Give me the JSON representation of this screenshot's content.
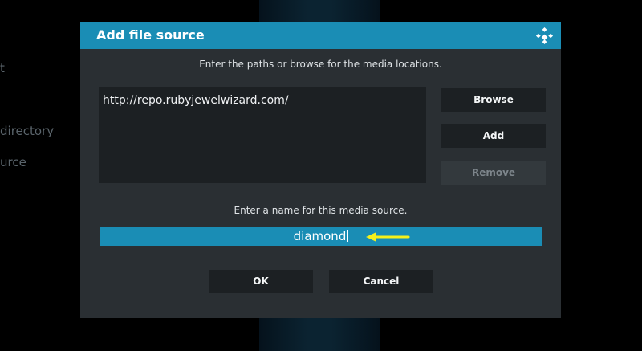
{
  "background": {
    "items": [
      "t",
      "directory",
      "urce"
    ]
  },
  "dialog": {
    "title": "Add file source",
    "paths_instruction": "Enter the paths or browse for the media locations.",
    "paths": [
      "http://repo.rubyjewelwizard.com/"
    ],
    "buttons": {
      "browse": "Browse",
      "add": "Add",
      "remove": "Remove"
    },
    "name_instruction": "Enter a name for this media source.",
    "name_value": "diamond",
    "ok_label": "OK",
    "cancel_label": "Cancel"
  },
  "colors": {
    "accent": "#1a8db5",
    "dialog_bg": "#2a2f33",
    "button_bg": "#1c2023",
    "arrow": "#f5f01a"
  },
  "icons": {
    "logo": "kodi-logo-icon",
    "annotation": "arrow-left-icon"
  }
}
